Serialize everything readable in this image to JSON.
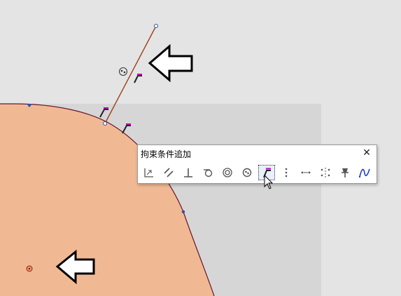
{
  "window": {
    "title": "拘束条件追加",
    "close_label": "✕"
  },
  "toolbar": {
    "tools": [
      {
        "icon": "horizontal-vertical-icon"
      },
      {
        "icon": "parallel-icon"
      },
      {
        "icon": "perpendicular-icon"
      },
      {
        "icon": "tangent-icon"
      },
      {
        "icon": "concentric-icon"
      },
      {
        "icon": "coincident-circle-icon"
      },
      {
        "icon": "coincident-point-icon",
        "active": true
      },
      {
        "icon": "midpoint-icon"
      },
      {
        "icon": "collinear-point-icon"
      },
      {
        "icon": "symmetric-icon"
      },
      {
        "icon": "fix-pin-icon"
      },
      {
        "icon": "smooth-curve-icon"
      }
    ]
  },
  "colors": {
    "background": "#e4e4e4",
    "sketch_plane": "#d6d6d6",
    "profile_fill": "#f0b994",
    "profile_edge": "#6b1530",
    "line": "#a0401a",
    "constraint_glyph": "#c000c0",
    "point": "#3050a0"
  }
}
